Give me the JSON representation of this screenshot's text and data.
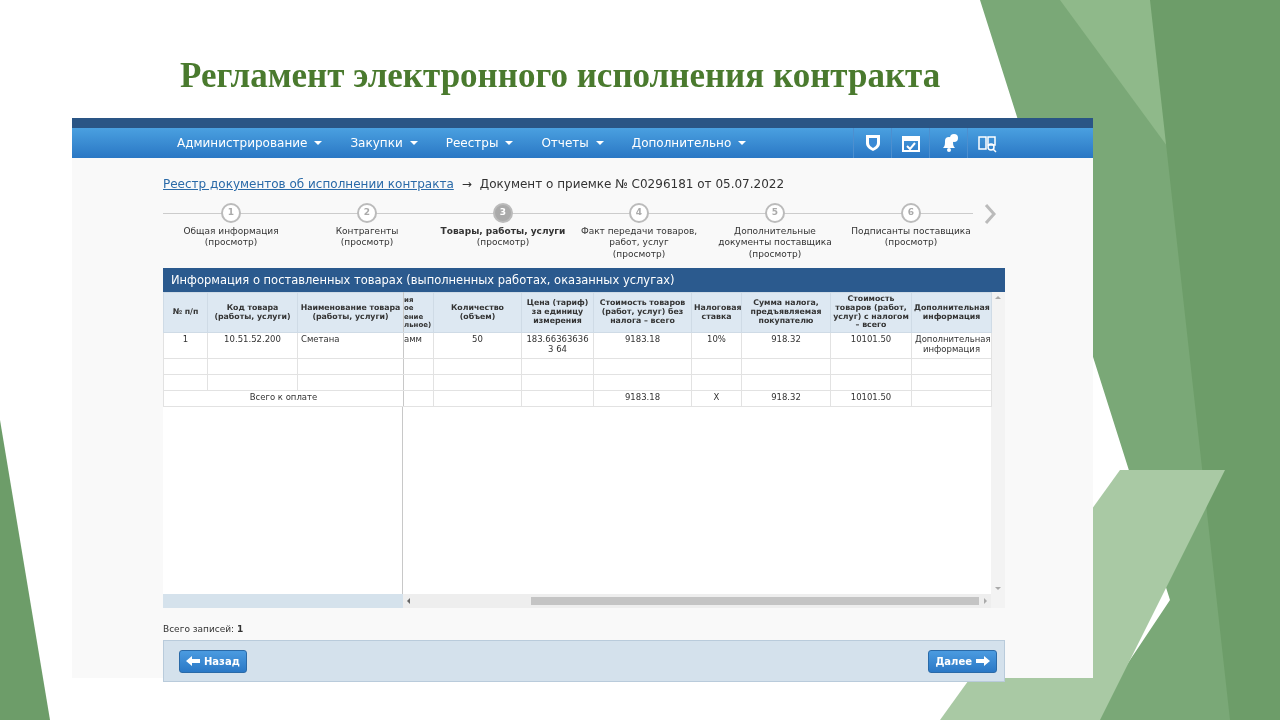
{
  "slide": {
    "title": "Регламент электронного исполнения контракта"
  },
  "nav": {
    "items": [
      {
        "label": "Администрирование"
      },
      {
        "label": "Закупки"
      },
      {
        "label": "Реестры"
      },
      {
        "label": "Отчеты"
      },
      {
        "label": "Дополнительно"
      }
    ]
  },
  "breadcrumb": {
    "link": "Реестр документов об исполнении контракта",
    "separator": "→",
    "current": "Документ о приемке № С0296181 от 05.07.2022"
  },
  "steps": [
    {
      "number": "1",
      "label": "Общая информация",
      "sublabel": "(просмотр)",
      "selected": false
    },
    {
      "number": "2",
      "label": "Контрагенты",
      "sublabel": "(просмотр)",
      "selected": false
    },
    {
      "number": "3",
      "label": "Товары, работы, услуги",
      "sublabel": "(просмотр)",
      "selected": true
    },
    {
      "number": "4",
      "label": "Факт передачи товаров, работ, услуг",
      "sublabel": "(просмотр)",
      "selected": false
    },
    {
      "number": "5",
      "label": "Дополнительные документы поставщика",
      "sublabel": "(просмотр)",
      "selected": false
    },
    {
      "number": "6",
      "label": "Подписанты поставщика",
      "sublabel": "(просмотр)",
      "selected": false
    }
  ],
  "table": {
    "title": "Информация о поставленных товарах (выполненных работах, оказанных услугах)",
    "columns": [
      {
        "label": "№ п/п",
        "kind": "text"
      },
      {
        "label": "Код товара (работы, услуги)",
        "kind": "text"
      },
      {
        "label": "Наименование товара (работы, услуги)",
        "kind": "text"
      },
      {
        "label": "ия ое ение льное)",
        "kind": "cut"
      },
      {
        "label": "Количество (объем)",
        "kind": "text"
      },
      {
        "label": "Цена (тариф) за единицу измерения",
        "kind": "text"
      },
      {
        "label": "Стоимость товаров (работ, услуг) без налога – всего",
        "kind": "text"
      },
      {
        "label": "Налоговая ставка",
        "kind": "text"
      },
      {
        "label": "Сумма налога, предъявляемая покупателю",
        "kind": "text"
      },
      {
        "label": "Стоимость товаров (работ, услуг) с налогом – всего",
        "kind": "text"
      },
      {
        "label": "Дополнительная информация",
        "kind": "link"
      }
    ],
    "rows": [
      {
        "kind": "data",
        "cells": [
          "1",
          "10.51.52.200",
          "Сметана",
          "амм",
          "50",
          "183.663636363 64",
          "9183.18",
          "10%",
          "918.32",
          "10101.50",
          "Дополнительная информация"
        ]
      },
      {
        "kind": "empty"
      },
      {
        "kind": "empty"
      },
      {
        "kind": "total",
        "label": "Всего к оплате",
        "cells": [
          "",
          "",
          "",
          "9183.18",
          "X",
          "918.32",
          "10101.50",
          ""
        ]
      }
    ]
  },
  "footer": {
    "records": "Всего записей: **1**",
    "back": "Назад",
    "next": "Далее"
  }
}
